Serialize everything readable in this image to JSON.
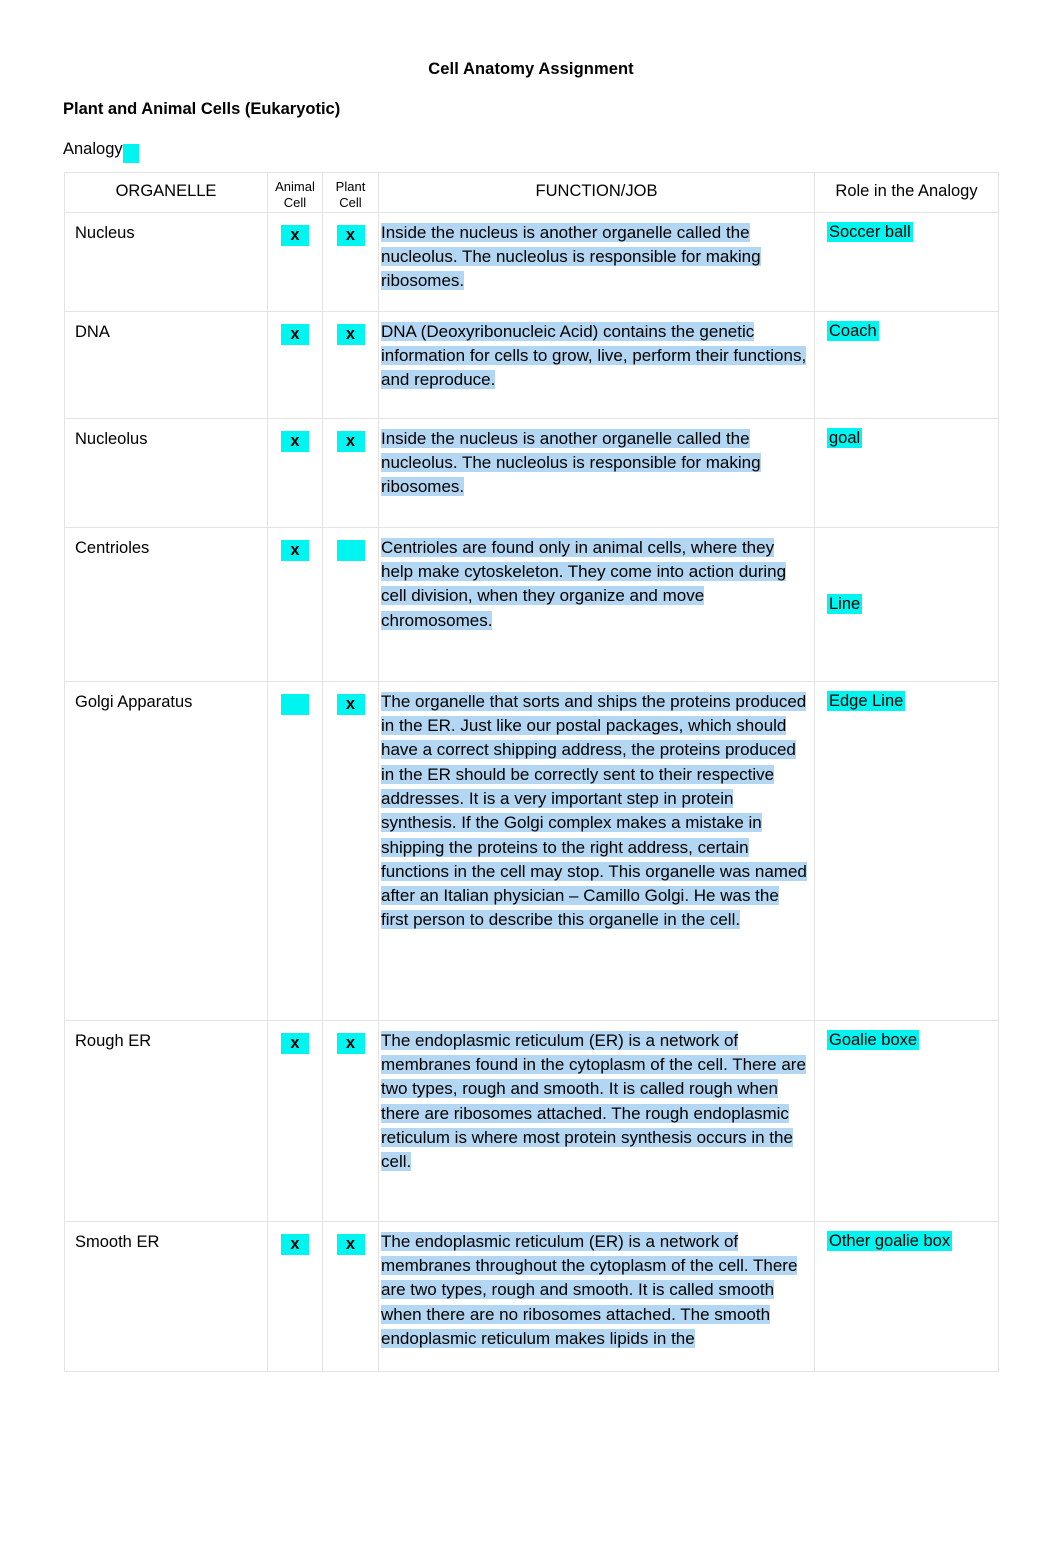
{
  "document": {
    "title": "Cell Anatomy Assignment",
    "subtitle": "Plant and Animal Cells (Eukaryotic)",
    "analogy_label": "Analogy"
  },
  "colors": {
    "highlight_cyan": "#00f5f0",
    "highlight_blue": "#b3d7f2",
    "table_border": "#e3e3e3",
    "text": "#000000",
    "page_background": "#ffffff"
  },
  "table": {
    "headers": {
      "organelle": "ORGANELLE",
      "animal_cell": "Animal Cell",
      "animal_cell_line1": "Animal",
      "animal_cell_line2": "Cell",
      "plant_cell": "Plant Cell",
      "plant_cell_line1": "Plant",
      "plant_cell_line2": "Cell",
      "function": "FUNCTION/JOB",
      "role": "Role in the Analogy"
    },
    "mark": "x",
    "rows": [
      {
        "organelle": "Nucleus",
        "animal": "x",
        "plant": "x",
        "function": " Inside the nucleus is another organelle called the nucleolus. The nucleolus is responsible for making ribosomes.",
        "role": "Soccer ball"
      },
      {
        "organelle": "DNA",
        "animal": "x",
        "plant": "x",
        "function": " DNA (Deoxyribonucleic Acid) contains the genetic information for cells to grow, live, perform their functions, and reproduce.",
        "role": "Coach"
      },
      {
        "organelle": "Nucleolus",
        "animal": "x",
        "plant": "x",
        "function": " Inside the nucleus is another organelle called the nucleolus. The nucleolus is responsible for making ribosomes.",
        "role": "goal"
      },
      {
        "organelle": "Centrioles",
        "animal": "x",
        "plant": "",
        "function": " Centrioles are found only in animal cells, where they help make cytoskeleton. They come into action during cell division, when they organize and move chromosomes.",
        "role": "Line"
      },
      {
        "organelle": "Golgi Apparatus",
        "animal": "",
        "plant": "x",
        "function": " The organelle that sorts and ships the proteins produced in the ER. Just like our postal packages, which should have a correct shipping address, the proteins produced in the ER should be correctly sent to their respective addresses. It is a very important step in protein synthesis. If the Golgi complex makes a mistake in shipping the proteins to the right address, certain functions in the cell may stop. This organelle was named after an Italian physician – Camillo Golgi. He was the first person to describe this organelle in the cell.",
        "role": "Edge Line"
      },
      {
        "organelle": "Rough ER",
        "animal": "x",
        "plant": "x",
        "function": " The endoplasmic reticulum (ER) is a network of membranes found in the cytoplasm of the cell. There are two types, rough and smooth. It is called rough when there are ribosomes attached. The rough endoplasmic reticulum is where most protein synthesis occurs in the cell.",
        "role": "Goalie boxe"
      },
      {
        "organelle": "Smooth ER",
        "animal": "x",
        "plant": "x",
        "function": " The endoplasmic reticulum (ER) is a network of membranes throughout the cytoplasm of the cell. There are two types, rough and smooth. It is called smooth when there are no ribosomes attached. The smooth endoplasmic reticulum makes lipids in the",
        "role": "Other goalie box"
      }
    ]
  }
}
